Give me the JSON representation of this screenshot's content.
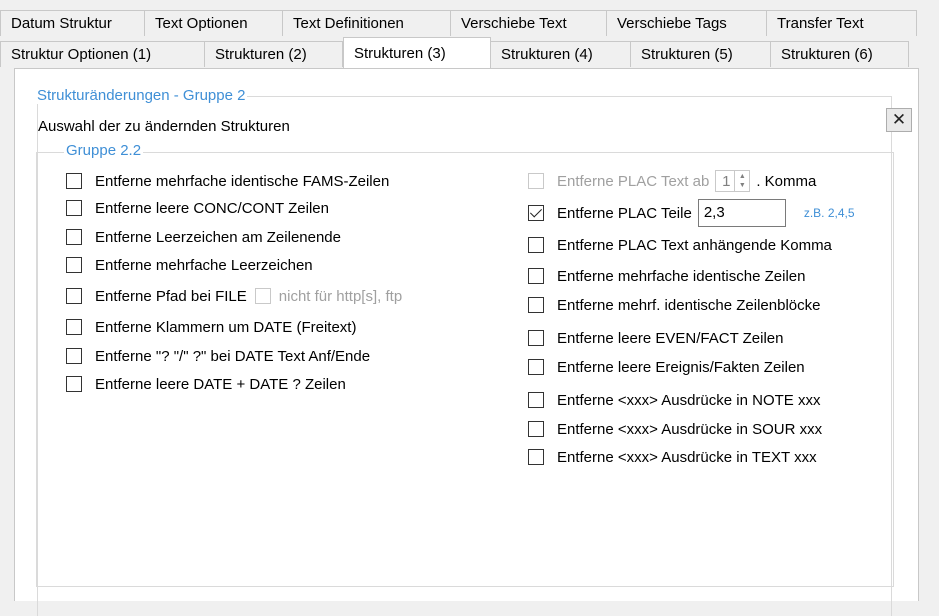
{
  "tabs_row1": [
    "Datum Struktur",
    "Text Optionen",
    "Text Definitionen",
    "Verschiebe Text",
    "Verschiebe Tags",
    "Transfer Text"
  ],
  "tabs_row2": [
    "Struktur Optionen (1)",
    "Strukturen (2)",
    "Strukturen (3)",
    "Strukturen (4)",
    "Strukturen (5)",
    "Strukturen (6)"
  ],
  "active_tab": "Strukturen (3)",
  "group_outer_title": "Strukturänderungen - Gruppe 2",
  "subtitle": "Auswahl der zu ändernden Strukturen",
  "close_symbol": "✕",
  "group_inner_title": "Gruppe 2.2",
  "left_options": [
    {
      "label": "Entferne mehrfache identische FAMS-Zeilen",
      "checked": false
    },
    {
      "label": "Entferne leere CONC/CONT Zeilen",
      "checked": false
    },
    {
      "label": "Entferne Leerzeichen am Zeilenende",
      "checked": false
    },
    {
      "label": "Entferne mehrfache Leerzeichen",
      "checked": false
    },
    {
      "label": "Entferne Pfad bei FILE",
      "checked": false
    },
    {
      "label": "Entferne Klammern um DATE (Freitext)",
      "checked": false
    },
    {
      "label": "Entferne \"? \"/\" ?\" bei DATE Text Anf/Ende",
      "checked": false
    },
    {
      "label": "Entferne leere DATE + DATE ? Zeilen",
      "checked": false
    }
  ],
  "file_suboption": {
    "label": "nicht für http[s], ftp",
    "checked": false,
    "enabled": false
  },
  "plac_text": {
    "label": "Entferne PLAC Text ab",
    "value": "1",
    "suffix": ". Komma",
    "checked": false,
    "enabled": false
  },
  "plac_teile": {
    "label": "Entferne PLAC Teile",
    "value": "2,3",
    "hint": "z.B. 2,4,5",
    "checked": true
  },
  "right_options": [
    {
      "label": "Entferne PLAC Text anhängende Komma",
      "checked": false
    },
    {
      "label": "Entferne mehrfache identische Zeilen",
      "checked": false
    },
    {
      "label": "Entferne mehrf. identische Zeilenblöcke",
      "checked": false
    },
    {
      "label": "Entferne leere EVEN/FACT Zeilen",
      "checked": false
    },
    {
      "label": "Entferne leere Ereignis/Fakten Zeilen",
      "checked": false
    },
    {
      "label": "Entferne <xxx> Ausdrücke in NOTE xxx",
      "checked": false
    },
    {
      "label": "Entferne <xxx> Ausdrücke in SOUR xxx",
      "checked": false
    },
    {
      "label": "Entferne <xxx> Ausdrücke in TEXT xxx",
      "checked": false
    }
  ]
}
